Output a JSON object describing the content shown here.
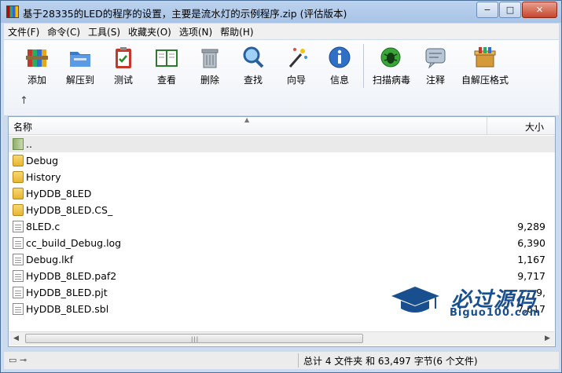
{
  "window": {
    "title": "基于28335的LED的程序的设置，主要是流水灯的示例程序.zip (评估版本)",
    "controls": {
      "minimize": "−",
      "maximize": "□",
      "close": "✕"
    }
  },
  "menu": [
    "文件(F)",
    "命令(C)",
    "工具(S)",
    "收藏夹(O)",
    "选项(N)",
    "帮助(H)"
  ],
  "toolbar": {
    "buttons": [
      {
        "label": "添加",
        "icon": "add-archive-icon"
      },
      {
        "label": "解压到",
        "icon": "extract-folder-icon"
      },
      {
        "label": "测试",
        "icon": "test-clipboard-icon"
      },
      {
        "label": "查看",
        "icon": "view-book-icon"
      },
      {
        "label": "删除",
        "icon": "delete-trash-icon"
      },
      {
        "label": "查找",
        "icon": "find-magnifier-icon"
      },
      {
        "label": "向导",
        "icon": "wizard-wand-icon"
      },
      {
        "label": "信息",
        "icon": "info-icon"
      },
      {
        "label": "扫描病毒",
        "icon": "virus-scan-icon"
      },
      {
        "label": "注释",
        "icon": "comment-icon"
      },
      {
        "label": "自解压格式",
        "icon": "sfx-box-icon"
      }
    ],
    "up_arrow": "↑"
  },
  "list": {
    "columns": {
      "name": "名称",
      "size": "大小"
    },
    "rows": [
      {
        "name": "..",
        "size": "",
        "type": "up"
      },
      {
        "name": "Debug",
        "size": "",
        "type": "folder"
      },
      {
        "name": "History",
        "size": "",
        "type": "folder"
      },
      {
        "name": "HyDDB_8LED",
        "size": "",
        "type": "folder"
      },
      {
        "name": "HyDDB_8LED.CS_",
        "size": "",
        "type": "folder"
      },
      {
        "name": "8LED.c",
        "size": "9,289",
        "type": "file"
      },
      {
        "name": "cc_build_Debug.log",
        "size": "6,390",
        "type": "file"
      },
      {
        "name": "Debug.lkf",
        "size": "1,167",
        "type": "file"
      },
      {
        "name": "HyDDB_8LED.paf2",
        "size": "9,717",
        "type": "file"
      },
      {
        "name": "HyDDB_8LED.pjt",
        "size": "9,",
        "type": "file"
      },
      {
        "name": "HyDDB_8LED.sbl",
        "size": "7,617",
        "type": "file"
      }
    ]
  },
  "status": {
    "summary": "总计 4 文件夹 和 63,497 字节(6 个文件)"
  },
  "watermark": {
    "big": "必过源码",
    "small": "Biguo100.com"
  },
  "colors": {
    "accent": "#1a4f8f",
    "close": "#c7462c"
  }
}
